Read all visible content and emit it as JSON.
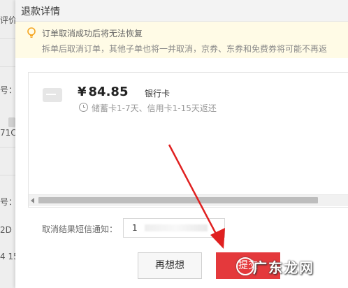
{
  "background": {
    "labels": [
      "评价",
      "号：",
      "71C",
      "号：",
      "2D",
      "4 15"
    ]
  },
  "modal": {
    "title": "退款详情",
    "notice": {
      "line1": "订单取消成功后将无法恢复",
      "line2": "拆单后取消订单，其他子单也将一并取消，京券、东券和免费券将可能不再返"
    },
    "refund": {
      "currency": "¥",
      "amount": "84.85",
      "method": "银行卡",
      "timeline": "储蓄卡1-7天、信用卡1-15天返还"
    },
    "sms": {
      "label": "取消结果短信通知：",
      "value": "1"
    },
    "buttons": {
      "cancel": "再想想",
      "submit": "提交"
    }
  },
  "watermark": "广东龙网",
  "colors": {
    "submit": "#e4393c",
    "notice_bg": "#fffbe6",
    "arrow": "#e02020"
  }
}
